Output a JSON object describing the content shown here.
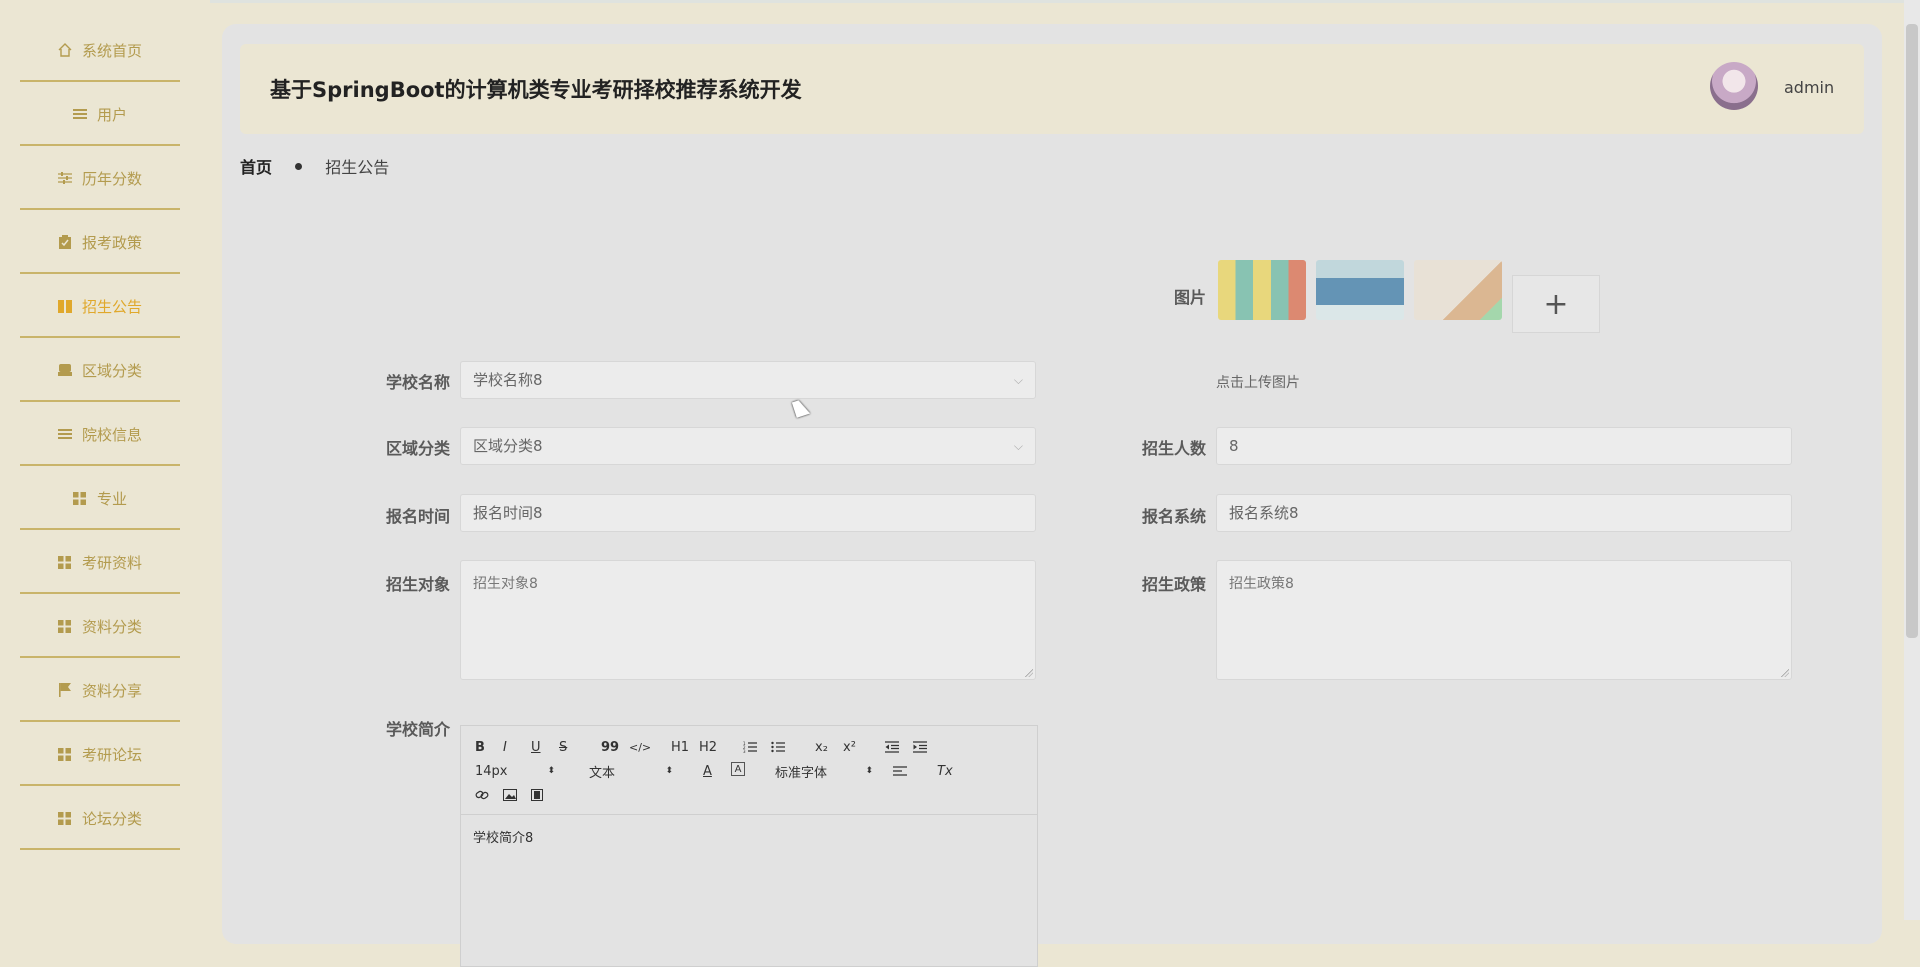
{
  "app": {
    "title": "基于SpringBoot的计算机类专业考研择校推荐系统开发",
    "user": "admin"
  },
  "sidebar": {
    "items": [
      {
        "label": "系统首页",
        "icon": "home-icon"
      },
      {
        "label": "用户",
        "icon": "list-icon"
      },
      {
        "label": "历年分数",
        "icon": "sliders-icon"
      },
      {
        "label": "报考政策",
        "icon": "clipboard-icon"
      },
      {
        "label": "招生公告",
        "icon": "book-icon",
        "active": true
      },
      {
        "label": "区域分类",
        "icon": "box-icon"
      },
      {
        "label": "院校信息",
        "icon": "list-icon"
      },
      {
        "label": "专业",
        "icon": "grid-icon"
      },
      {
        "label": "考研资料",
        "icon": "grid-icon"
      },
      {
        "label": "资料分类",
        "icon": "grid-icon"
      },
      {
        "label": "资料分享",
        "icon": "flag-icon"
      },
      {
        "label": "考研论坛",
        "icon": "grid-icon"
      },
      {
        "label": "论坛分类",
        "icon": "grid-icon"
      }
    ]
  },
  "breadcrumb": {
    "home": "首页",
    "current": "招生公告"
  },
  "form": {
    "image_label": "图片",
    "upload_hint": "点击上传图片",
    "school_name": {
      "label": "学校名称",
      "value": "学校名称8"
    },
    "region": {
      "label": "区域分类",
      "value": "区域分类8"
    },
    "enroll_count": {
      "label": "招生人数",
      "value": "8"
    },
    "reg_time": {
      "label": "报名时间",
      "value": "报名时间8"
    },
    "reg_system": {
      "label": "报名系统",
      "value": "报名系统8"
    },
    "target": {
      "label": "招生对象",
      "value": "招生对象8"
    },
    "policy": {
      "label": "招生政策",
      "value": "招生政策8"
    },
    "intro": {
      "label": "学校简介",
      "value": "学校简介8"
    }
  },
  "editor": {
    "font_size": "14px",
    "text_type": "文本",
    "font_family": "标准字体",
    "toolbar_labels": {
      "bold": "B",
      "italic": "I",
      "underline": "U",
      "strike": "S",
      "quote": "99",
      "code": "</>",
      "h1": "H1",
      "h2": "H2",
      "sub": "x₂",
      "sup": "x²",
      "clear": "Tx"
    }
  },
  "colors": {
    "accent": "#c9b46a",
    "active": "#e0a82b",
    "sidebar_bg": "#ebe6d3"
  }
}
